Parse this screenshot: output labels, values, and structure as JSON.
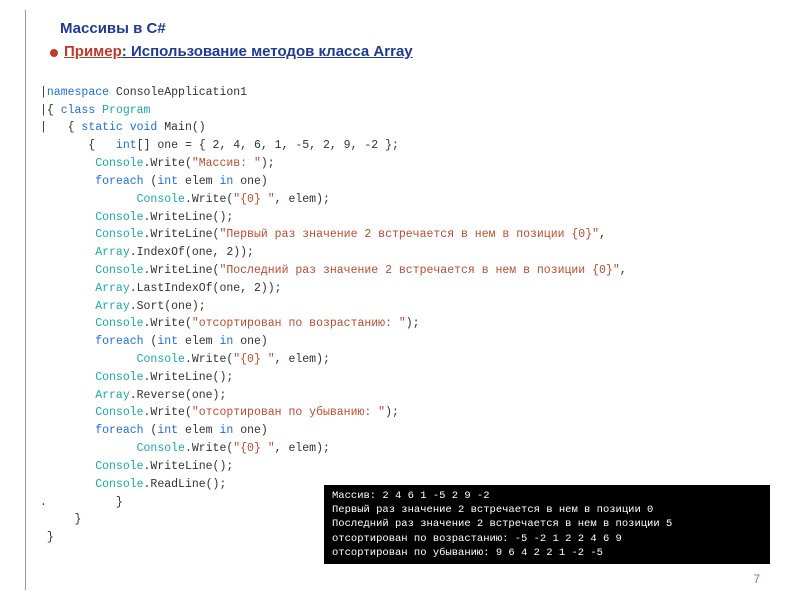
{
  "header": {
    "title": "Массивы в C#",
    "primer": "Пример",
    "subtitle_rest": ": Использование методов класса Array "
  },
  "code": {
    "l1a": "namespace",
    "l1b": " ConsoleApplication1",
    "l2a": "{ ",
    "l2b": "class",
    "l2c": " Program",
    "l3a": "   { ",
    "l3b": "static void",
    "l3c": " Main()",
    "l4a": "       {   ",
    "l4b": "int",
    "l4c": "[] one = { 2, 4, 6, 1, -5, 2, 9, -2 };",
    "l5a": "        ",
    "l5b": "Console",
    "l5c": ".Write(",
    "l5d": "\"Массив: \"",
    "l5e": ");",
    "l6a": "        ",
    "l6b": "foreach",
    "l6c": " (",
    "l6d": "int",
    "l6e": " elem ",
    "l6f": "in",
    "l6g": " one)",
    "l7a": "              ",
    "l7b": "Console",
    "l7c": ".Write(",
    "l7d": "\"{0} \"",
    "l7e": ", elem);",
    "l8a": "        ",
    "l8b": "Console",
    "l8c": ".WriteLine();",
    "l9a": "        ",
    "l9b": "Console",
    "l9c": ".WriteLine(",
    "l9d": "\"Первый раз значение 2 встречается в нем в позиции {0}\"",
    "l9e": ",",
    "l10a": "        ",
    "l10b": "Array",
    "l10c": ".IndexOf(one, 2));",
    "l11a": "        ",
    "l11b": "Console",
    "l11c": ".WriteLine(",
    "l11d": "\"Последний раз значение 2 встречается в нем в позиции {0}\"",
    "l11e": ",",
    "l12a": "        ",
    "l12b": "Array",
    "l12c": ".LastIndexOf(one, 2));",
    "l13a": "        ",
    "l13b": "Array",
    "l13c": ".Sort(one);",
    "l14a": "        ",
    "l14b": "Console",
    "l14c": ".Write(",
    "l14d": "\"отсортирован по возрастанию: \"",
    "l14e": ");",
    "l15a": "        ",
    "l15b": "foreach",
    "l15c": " (",
    "l15d": "int",
    "l15e": " elem ",
    "l15f": "in",
    "l15g": " one)",
    "l16a": "              ",
    "l16b": "Console",
    "l16c": ".Write(",
    "l16d": "\"{0} \"",
    "l16e": ", elem);",
    "l17a": "        ",
    "l17b": "Console",
    "l17c": ".WriteLine();",
    "l18a": "        ",
    "l18b": "Array",
    "l18c": ".Reverse(one);",
    "l19a": "        ",
    "l19b": "Console",
    "l19c": ".Write(",
    "l19d": "\"отсортирован по убыванию: \"",
    "l19e": ");",
    "l20a": "        ",
    "l20b": "foreach",
    "l20c": " (",
    "l20d": "int",
    "l20e": " elem ",
    "l20f": "in",
    "l20g": " one)",
    "l21a": "              ",
    "l21b": "Console",
    "l21c": ".Write(",
    "l21d": "\"{0} \"",
    "l21e": ", elem);",
    "l22a": "        ",
    "l22b": "Console",
    "l22c": ".WriteLine();",
    "l23a": "        ",
    "l23b": "Console",
    "l23c": ".ReadLine();",
    "l24": ".          }",
    "l25": "     }",
    "l26": " }"
  },
  "output": {
    "line1": "Массив: 2 4 6 1 -5 2 9 -2",
    "line2": "Первый раз значение 2 встречается в нем в позиции 0",
    "line3": "Последний раз значение 2 встречается в нем в позиции 5",
    "line4": "отсортирован по возрастанию: -5 -2 1 2 2 4 6 9",
    "line5": "отсортирован по убыванию: 9 6 4 2 2 1 -2 -5"
  },
  "pagenum": "7"
}
